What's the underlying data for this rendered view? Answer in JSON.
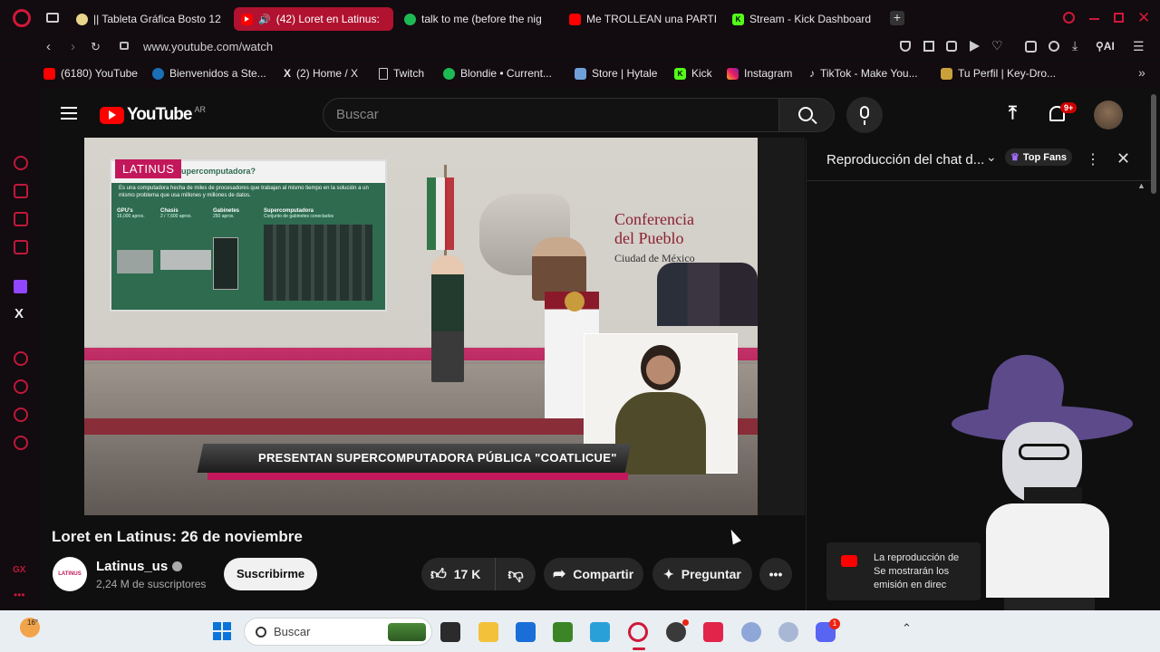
{
  "tabs": [
    {
      "label": "|| Tableta Gráfica Bosto 12",
      "active": false,
      "icon": "pill-icon"
    },
    {
      "label": "(42) Loret en Latinus:",
      "active": true,
      "icon": "youtube-icon"
    },
    {
      "label": "talk to me (before the nig",
      "active": false,
      "icon": "spotify-icon"
    },
    {
      "label": "Me TROLLEAN una PARTI",
      "active": false,
      "icon": "youtube-icon"
    },
    {
      "label": "Stream - Kick Dashboard",
      "active": false,
      "icon": "kick-icon"
    }
  ],
  "address": {
    "url": "www.youtube.com/watch",
    "ai_label": "AI"
  },
  "bookmarks": [
    {
      "label": "(6180) YouTube",
      "icon": "youtube-icon"
    },
    {
      "label": "Bienvenidos a Ste...",
      "icon": "steam-icon"
    },
    {
      "label": "(2) Home / X",
      "icon": "x-icon"
    },
    {
      "label": "Twitch",
      "icon": "page-icon"
    },
    {
      "label": "Blondie • Current...",
      "icon": "spotify-icon"
    },
    {
      "label": "Store | Hytale",
      "icon": "hytale-icon"
    },
    {
      "label": "Kick",
      "icon": "kick-icon"
    },
    {
      "label": "Instagram",
      "icon": "instagram-icon"
    },
    {
      "label": "TikTok - Make You...",
      "icon": "tiktok-icon"
    },
    {
      "label": "Tu Perfil | Key-Dro...",
      "icon": "keydrop-icon"
    }
  ],
  "yt": {
    "logo_text": "YouTube",
    "region": "AR",
    "search_placeholder": "Buscar",
    "notifications_badge": "9+"
  },
  "video": {
    "brand": "LATINUS",
    "slide_title": "supercomputadora?",
    "slide_text": "Es una computadora hecha de miles de procesadores que trabajan al mismo tiempo en la solución a un mismo problema que usa millones y millones de datos.",
    "slide_cols": [
      {
        "head": "GPU's",
        "body": "16,000 aprox."
      },
      {
        "head": "Chasis",
        "body": "2 / 7,600 aprox."
      },
      {
        "head": "Gabinetes",
        "body": "250 aprox."
      },
      {
        "head": "Supercomputadora",
        "body": "Conjunto de gabinetes conectados"
      }
    ],
    "conf_line1": "Conferencia",
    "conf_line2": "del Pueblo",
    "conf_line3": "Ciudad de México",
    "lower_third": "PRESENTAN SUPERCOMPUTADORA PÚBLICA \"COATLICUE\""
  },
  "watch": {
    "title": "Loret en Latinus: 26 de noviembre",
    "channel": "Latinus_us",
    "channel_avatar_text": "LATINUS",
    "subscribers": "2,24 M de suscriptores",
    "subscribe_label": "Suscribirme",
    "likes": "17 K",
    "share_label": "Compartir",
    "ask_label": "Preguntar"
  },
  "chat": {
    "title": "Reproducción del chat d...",
    "top_fans": "Top Fans",
    "notice_line1": "La reproducción de",
    "notice_line2": "Se mostrarán los",
    "notice_line3": "emisión en direc"
  },
  "taskbar": {
    "weather": "16°",
    "search_placeholder": "Buscar",
    "discord_badge": "1"
  },
  "colors": {
    "accent": "#b01230",
    "youtube_red": "#ff0000",
    "latinus_magenta": "#c2185b",
    "slide_green": "#2e6b4f"
  }
}
